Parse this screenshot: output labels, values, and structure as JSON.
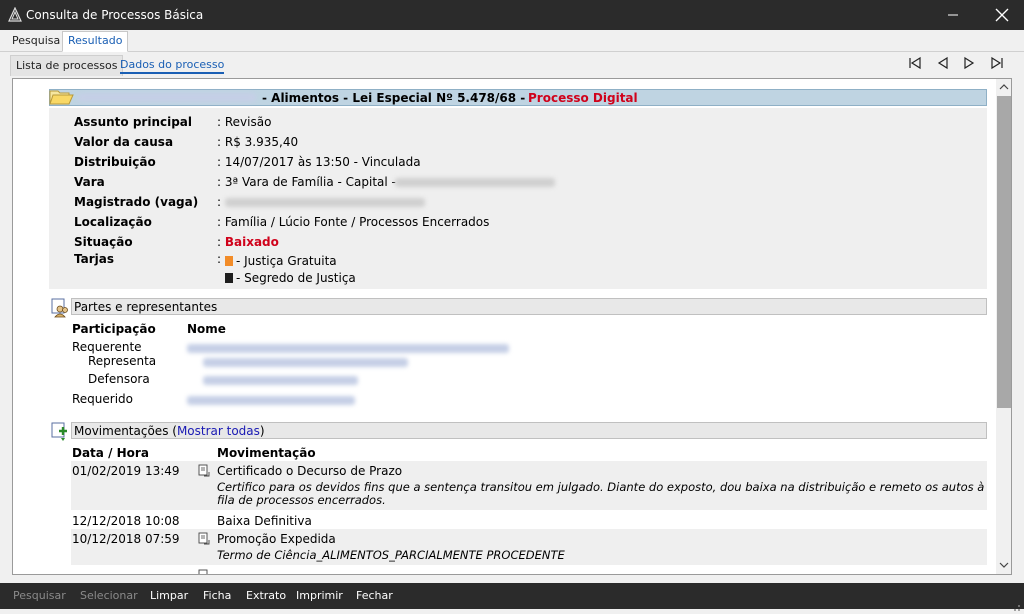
{
  "window": {
    "title": "Consulta de Processos Básica"
  },
  "top_tabs": [
    "Pesquisa",
    "Resultado"
  ],
  "sub_tabs": [
    "Lista de processos",
    "Dados do processo"
  ],
  "process": {
    "heading": "- Alimentos - Lei Especial Nº 5.478/68 -",
    "tag": "Processo Digital",
    "fields": [
      {
        "label": "Assunto principal",
        "value": ": Revisão"
      },
      {
        "label": "Valor da causa",
        "value": ": R$ 3.935,40"
      },
      {
        "label": "Distribuição",
        "value": ": 14/07/2017 às 13:50 - Vinculada"
      },
      {
        "label": "Vara",
        "value": ": 3ª Vara de Família - Capital -"
      },
      {
        "label": "Magistrado (vaga)",
        "value": ":"
      },
      {
        "label": "Localização",
        "value": ": Família / Lúcio Fonte / Processos Encerrados"
      },
      {
        "label": "Situação",
        "value": ": ",
        "status": "Baixado"
      },
      {
        "label": "Tarjas",
        "value": ":"
      }
    ],
    "tarjas": [
      {
        "label": "- Justiça Gratuita",
        "color": "#f28c28"
      },
      {
        "label": "- Segredo de Justiça",
        "color": "#1e1e1e"
      }
    ],
    "status_color": "#d0021b"
  },
  "parties": {
    "section_title": "Partes e representantes",
    "col_participacao": "Participação",
    "col_nome": "Nome",
    "rows": [
      {
        "role": "Requerente"
      },
      {
        "role": "Representa"
      },
      {
        "role": "Defensora"
      },
      {
        "role": "Requerido"
      }
    ]
  },
  "movements": {
    "section_title": "Movimentações (",
    "show_all": "Mostrar todas",
    "section_close": ")",
    "col_date": "Data / Hora",
    "col_mov": "Movimentação",
    "rows": [
      {
        "date": "01/02/2019 13:49",
        "title": "Certificado o Decurso de Prazo",
        "detail": "Certifico para os devidos fins que a sentença transitou em julgado. Diante do exposto, dou baixa na distribuição e remeto os autos à",
        "detail2": "fila de processos encerrados."
      },
      {
        "date": "12/12/2018 10:08",
        "title": "Baixa Definitiva",
        "detail": "",
        "detail2": ""
      },
      {
        "date": "10/12/2018 07:59",
        "title": "Promoção Expedida",
        "detail": "Termo de Ciência_ALIMENTOS_PARCIALMENTE PROCEDENTE",
        "detail2": ""
      }
    ]
  },
  "bottom_buttons": [
    {
      "label": "Pesquisar",
      "enabled": false
    },
    {
      "label": "Selecionar",
      "enabled": false
    },
    {
      "label": "Limpar",
      "enabled": true
    },
    {
      "label": "Ficha",
      "enabled": true
    },
    {
      "label": "Extrato",
      "enabled": true
    },
    {
      "label": "Imprimir",
      "enabled": true
    },
    {
      "label": "Fechar",
      "enabled": true
    }
  ]
}
